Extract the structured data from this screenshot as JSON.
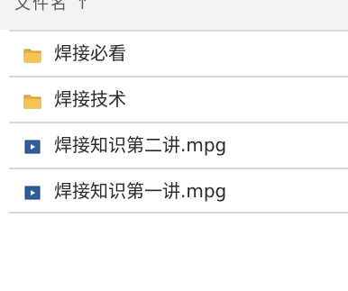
{
  "header": {
    "partial_title": "文件名 ↑"
  },
  "files": [
    {
      "name": "焊接必看",
      "icon": "folder-icon",
      "icon_color": "#e8b23a"
    },
    {
      "name": "焊接技术",
      "icon": "folder-icon",
      "icon_color": "#e8b23a"
    },
    {
      "name": "焊接知识第二讲.mpg",
      "icon": "video-file-icon",
      "icon_color": "#2f5f9b"
    },
    {
      "name": "焊接知识第一讲.mpg",
      "icon": "video-file-icon",
      "icon_color": "#2f5f9b"
    }
  ]
}
